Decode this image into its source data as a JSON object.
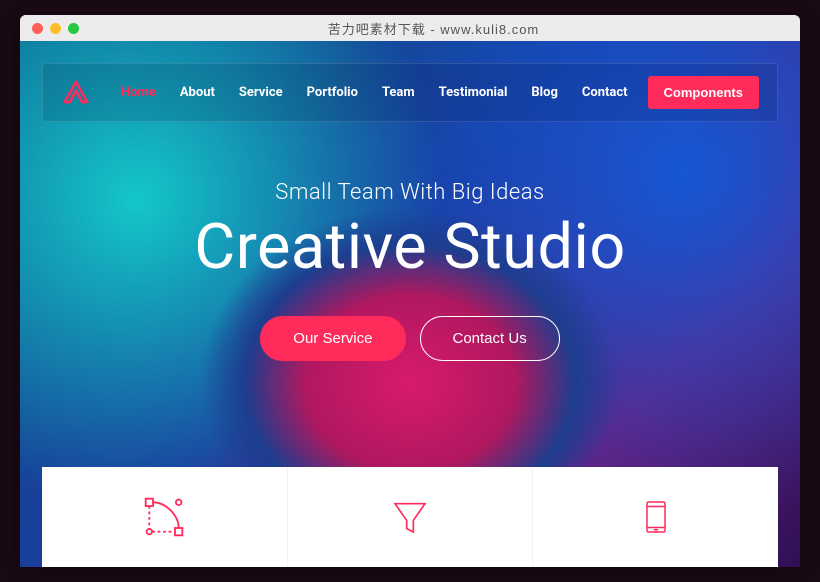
{
  "window": {
    "title": "苦力吧素材下载 - www.kuli8.com"
  },
  "nav": {
    "items": [
      "Home",
      "About",
      "Service",
      "Portfolio",
      "Team",
      "Testimonial",
      "Blog",
      "Contact"
    ],
    "activeIndex": 0,
    "cta": "Components"
  },
  "hero": {
    "subtitle": "Small Team With Big Ideas",
    "title": "Creative Studio",
    "primaryBtn": "Our Service",
    "secondaryBtn": "Contact Us"
  },
  "features": {
    "icons": [
      "vector-icon",
      "funnel-icon",
      "mobile-icon"
    ]
  },
  "colors": {
    "accent": "#ff2b5a"
  }
}
